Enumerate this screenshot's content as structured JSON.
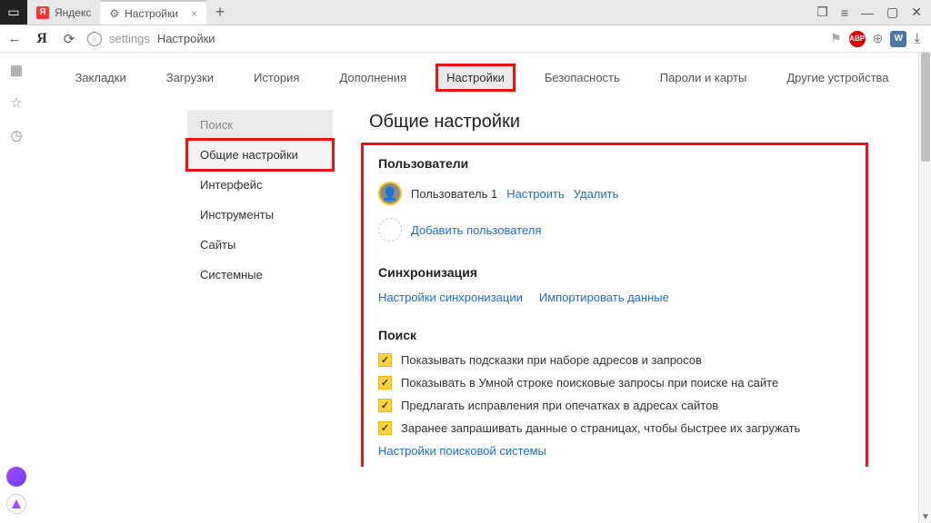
{
  "titlebar": {
    "tabs": [
      {
        "label": "Яндекс",
        "favicon": "Я"
      },
      {
        "label": "Настройки",
        "favicon": "gear",
        "active": true
      }
    ],
    "controls": {
      "panel": "❐",
      "menu": "≡",
      "min": "—",
      "max": "▢",
      "close": "✕"
    }
  },
  "addrbar": {
    "back": "←",
    "reload": "⟳",
    "ya": "Я",
    "path_host": "settings",
    "path_page": "Настройки",
    "bookmark": "⚑",
    "ext_abp": "ABP",
    "ext_vk": "W",
    "ext_dl": "⤓"
  },
  "leftrail": {
    "grid": "▦",
    "star": "☆",
    "clock": "◷"
  },
  "topnav": {
    "items": [
      "Закладки",
      "Загрузки",
      "История",
      "Дополнения",
      "Настройки",
      "Безопасность",
      "Пароли и карты",
      "Другие устройства"
    ],
    "active_index": 4
  },
  "sidenav": {
    "items": [
      "Поиск",
      "Общие настройки",
      "Интерфейс",
      "Инструменты",
      "Сайты",
      "Системные"
    ],
    "active_index": 1
  },
  "panel": {
    "title": "Общие настройки",
    "users": {
      "heading": "Пользователи",
      "user1_name": "Пользователь 1",
      "configure": "Настроить",
      "delete": "Удалить",
      "add": "Добавить пользователя"
    },
    "sync": {
      "heading": "Синхронизация",
      "settings": "Настройки синхронизации",
      "import": "Импортировать данные"
    },
    "search": {
      "heading": "Поиск",
      "opts": [
        "Показывать подсказки при наборе адресов и запросов",
        "Показывать в Умной строке поисковые запросы при поиске на сайте",
        "Предлагать исправления при опечатках в адресах сайтов",
        "Заранее запрашивать данные о страницах, чтобы быстрее их загружать"
      ],
      "engine_link": "Настройки поисковой системы"
    }
  }
}
